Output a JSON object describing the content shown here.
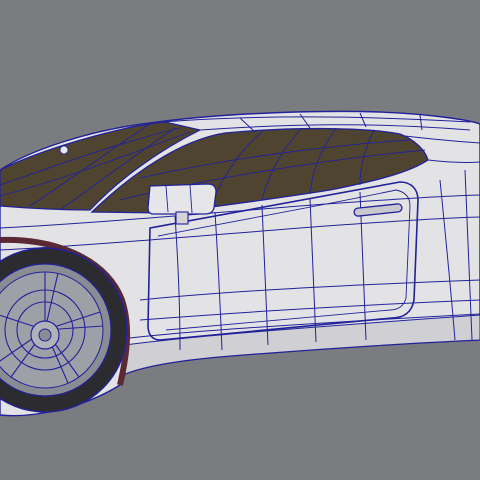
{
  "viewport": {
    "background_color": "#7a7c7f",
    "wire_color": "#22229a",
    "body_color": "#e3e3e6",
    "glass_color": "#4e4430",
    "tire_color": "#2c2c30",
    "rim_color": "#9ea0a8"
  },
  "model": {
    "icon": "car-wireframe-model"
  }
}
